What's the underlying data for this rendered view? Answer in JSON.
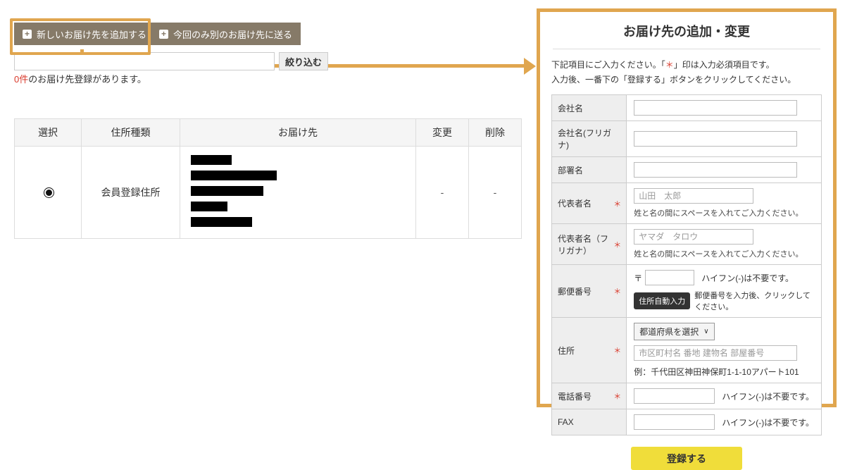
{
  "toolbar": {
    "plus_icon": "+",
    "add_button_label": "新しいお届け先を追加する",
    "send_once_button_label": "今回のみ別のお届け先に送る",
    "filter_input_value": "",
    "filter_button_label": "絞り込む"
  },
  "count_line": {
    "count": "0件",
    "text": "のお届け先登録があります。"
  },
  "table": {
    "headers": [
      "選択",
      "住所種類",
      "お届け先",
      "変更",
      "削除"
    ],
    "row": {
      "address_type": "会員登録住所",
      "change": "-",
      "delete": "-",
      "redacted_bar_widths": [
        58,
        122,
        103,
        52,
        87
      ]
    }
  },
  "panel": {
    "title": "お届け先の追加・変更",
    "instructions": {
      "line1_pre": "下記項目にご入力ください。「",
      "required_mark": "＊",
      "line1_post": "」印は入力必須項目です。",
      "line2": "入力後、一番下の「登録する」ボタンをクリックしてください。"
    },
    "rows": [
      {
        "label": "会社名"
      },
      {
        "label": "会社名(フリガナ)"
      },
      {
        "label": "部署名"
      },
      {
        "label": "代表者名",
        "mark": "＊",
        "placeholder": "山田　太郎",
        "helper": "姓と名の間にスペースを入れてご入力ください。"
      },
      {
        "label": "代表者名（フリガナ）",
        "mark": "＊",
        "placeholder": "ヤマダ　タロウ",
        "helper": "姓と名の間にスペースを入れてご入力ください。"
      },
      {
        "label": "郵便番号",
        "mark": "＊",
        "postal_prefix": "〒",
        "note": "ハイフン(-)は不要です。",
        "auto_button_label": "住所自動入力",
        "auto_note": "郵便番号を入力後、クリックしてください。"
      },
      {
        "label": "住所",
        "mark": "＊",
        "select_label": "都道府県を選択",
        "select_caret": "∨",
        "placeholder": "市区町村名 番地 建物名 部屋番号",
        "example": "例：千代田区神田神保町1-1-10アパート101"
      },
      {
        "label": "電話番号",
        "mark": "＊",
        "note": "ハイフン(-)は不要です。"
      },
      {
        "label": "FAX",
        "note": "ハイフン(-)は不要です。"
      }
    ],
    "submit_button_label": "登録する"
  }
}
